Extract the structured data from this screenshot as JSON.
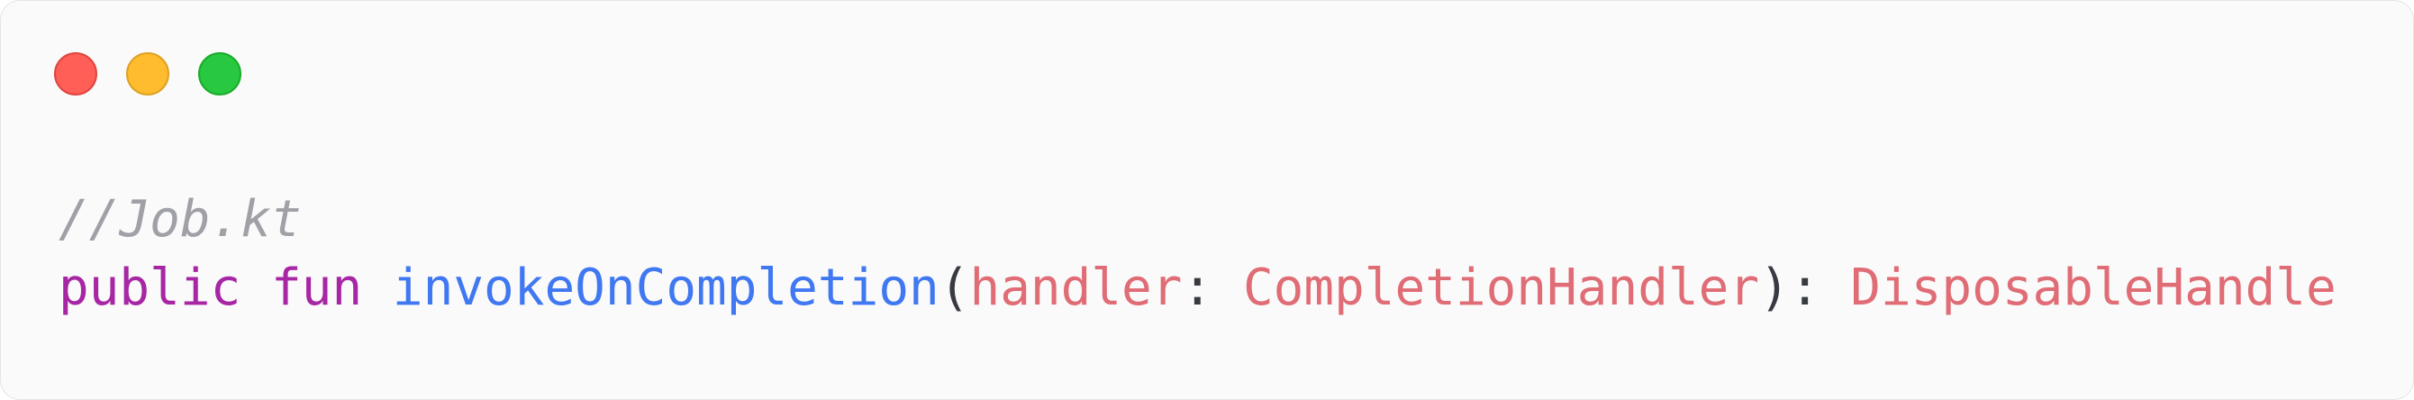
{
  "window": {
    "controls": {
      "close": "close-dot",
      "minimize": "minimize-dot",
      "zoom": "zoom-dot"
    }
  },
  "code": {
    "comment": "//Job.kt",
    "kw_public": "public",
    "kw_fun": "fun",
    "function_name": "invokeOnCompletion",
    "paren_open": "(",
    "param_name": "handler",
    "colon_1": ": ",
    "param_type": "CompletionHandler",
    "paren_close": ")",
    "colon_2": ": ",
    "return_type": "DisposableHandle"
  },
  "colors": {
    "keyword": "#a626a4",
    "function": "#4078f2",
    "param": "#e06c75",
    "comment": "#a0a1a7",
    "close": "#ff5f57",
    "minimize": "#febc2e",
    "zoom": "#28c840"
  }
}
